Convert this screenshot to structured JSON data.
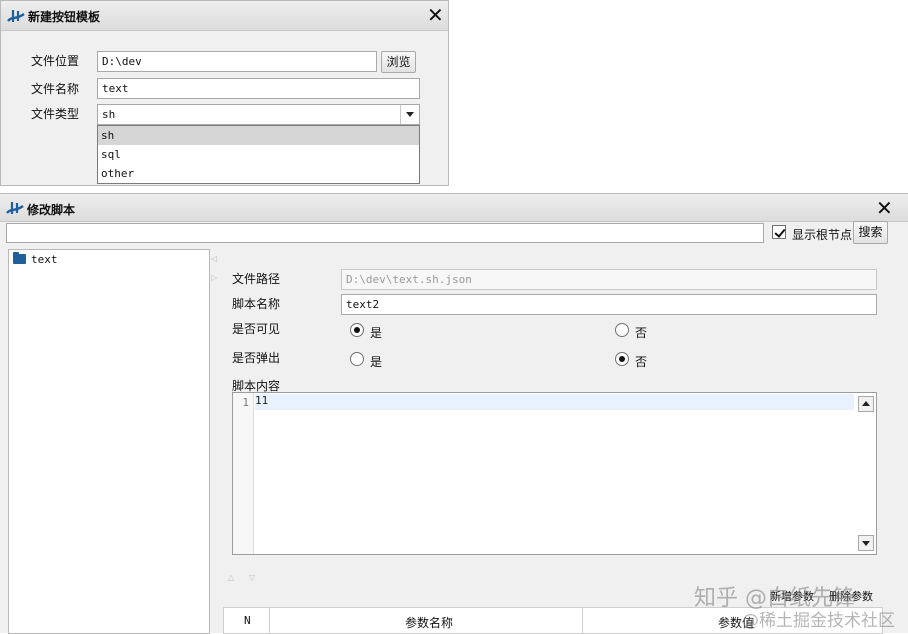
{
  "dialog1": {
    "title": "新建按钮模板",
    "close_icon": "close-icon",
    "labels": {
      "location": "文件位置",
      "name": "文件名称",
      "type": "文件类型"
    },
    "location_value": "D:\\dev",
    "browse_label": "浏览",
    "name_value": "text",
    "type_value": "sh",
    "type_options": [
      "sh",
      "sql",
      "other"
    ]
  },
  "dialog2": {
    "title": "修改脚本",
    "search_value": "",
    "show_root_label": "显示根节点",
    "show_root_checked": true,
    "search_label": "搜索",
    "tree_items": [
      "text"
    ],
    "labels": {
      "path": "文件路径",
      "script_name": "脚本名称",
      "visible": "是否可见",
      "popup": "是否弹出",
      "content": "脚本内容"
    },
    "path_value": "D:\\dev\\text.sh.json",
    "script_name_value": "text2",
    "yes_label": "是",
    "no_label": "否",
    "visible_value": "是",
    "popup_value": "否",
    "editor": {
      "line_number": "1",
      "code": "11"
    },
    "add_param_label": "新增参数",
    "del_param_label": "删除参数",
    "table_headers": [
      "N",
      "参数名称",
      "参数值"
    ]
  },
  "watermark": {
    "line1": "知乎 @白纸先锋",
    "line2": "@稀土掘金技术社区"
  }
}
